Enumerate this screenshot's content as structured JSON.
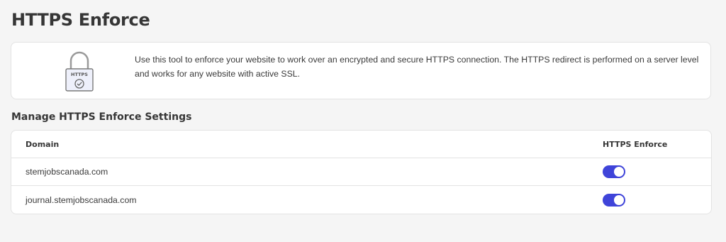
{
  "page": {
    "title": "HTTPS Enforce"
  },
  "info": {
    "icon": "https-lock-icon",
    "lock_label": "HTTPS",
    "text": "Use this tool to enforce your website to work over an encrypted and secure HTTPS connection. The HTTPS redirect is performed on a server level and works for any website with active SSL."
  },
  "settings": {
    "title": "Manage HTTPS Enforce Settings",
    "columns": {
      "domain": "Domain",
      "enforce": "HTTPS Enforce"
    },
    "rows": [
      {
        "domain": "stemjobscanada.com",
        "enforced": true
      },
      {
        "domain": "journal.stemjobscanada.com",
        "enforced": true
      }
    ]
  },
  "colors": {
    "toggle_on": "#3f44d9",
    "background": "#f5f5f5",
    "card": "#ffffff",
    "border": "#e3e3e3"
  }
}
